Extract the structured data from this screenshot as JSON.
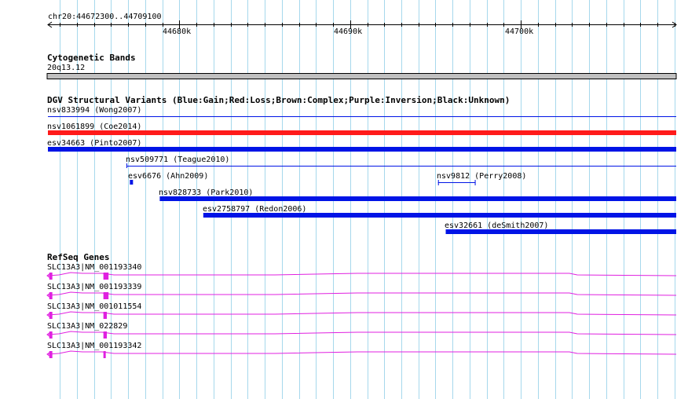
{
  "region": {
    "label": "chr20:44672300..44709100",
    "start": 44672300,
    "end": 44709100,
    "ticks": [
      {
        "pos": 44680000,
        "label": "44680k"
      },
      {
        "pos": 44690000,
        "label": "44690k"
      },
      {
        "pos": 44700000,
        "label": "44700k"
      }
    ]
  },
  "colors": {
    "grid": "#a6d8ec",
    "gain": "#0014e6",
    "loss": "#ff1a1a",
    "gene": "#e020e0",
    "band": "#c0c0c0"
  },
  "cytobands": {
    "title": "Cytogenetic Bands",
    "band_label": "20q13.12"
  },
  "dgv": {
    "title": "DGV Structural Variants (Blue:Gain;Red:Loss;Brown:Complex;Purple:Inversion;Black:Unknown)",
    "variants": [
      {
        "label": "nsv833994 (Wong2007)",
        "type": "gain",
        "style": "thin",
        "start": 44672300,
        "end": 44709100
      },
      {
        "label": "nsv1061899 (Coe2014)",
        "type": "loss",
        "style": "thick",
        "start": 44672300,
        "end": 44709100
      },
      {
        "label": "esv34663 (Pinto2007)",
        "type": "gain",
        "style": "thick",
        "start": 44672300,
        "end": 44709100
      },
      {
        "label": "nsv509771 (Teague2010)",
        "type": "gain",
        "style": "thin",
        "start": 44676900,
        "end": 44709100
      },
      {
        "label": "esv6676 (Ahn2009)",
        "type": "gain",
        "style": "thick",
        "start": 44677100,
        "end": 44677250
      },
      {
        "label": "nsv9812 (Perry2008)",
        "type": "gain",
        "style": "bracket",
        "start": 44695150,
        "end": 44697350
      },
      {
        "label": "nsv828733 (Park2010)",
        "type": "gain",
        "style": "thick",
        "start": 44678850,
        "end": 44709100
      },
      {
        "label": "esv2758797 (Redon2006)",
        "type": "gain",
        "style": "thick",
        "start": 44681400,
        "end": 44709100
      },
      {
        "label": "esv32661 (deSmith2007)",
        "type": "gain",
        "style": "thick",
        "start": 44695600,
        "end": 44709100
      }
    ]
  },
  "refseq": {
    "title": "RefSeq Genes",
    "genes": [
      {
        "label": "SLC13A3|NM_001193340",
        "exons": [
          [
            44672380,
            44672560
          ],
          [
            44675550,
            44675850
          ]
        ]
      },
      {
        "label": "SLC13A3|NM_001193339",
        "exons": [
          [
            44672380,
            44672560
          ],
          [
            44675550,
            44675850
          ]
        ]
      },
      {
        "label": "SLC13A3|NM_001011554",
        "exons": [
          [
            44672380,
            44672560
          ],
          [
            44675550,
            44675750
          ]
        ]
      },
      {
        "label": "SLC13A3|NM_022829",
        "exons": [
          [
            44672380,
            44672560
          ],
          [
            44675550,
            44675750
          ]
        ]
      },
      {
        "label": "SLC13A3|NM_001193342",
        "exons": [
          [
            44672380,
            44672560
          ],
          [
            44675550,
            44675650
          ]
        ]
      }
    ]
  }
}
